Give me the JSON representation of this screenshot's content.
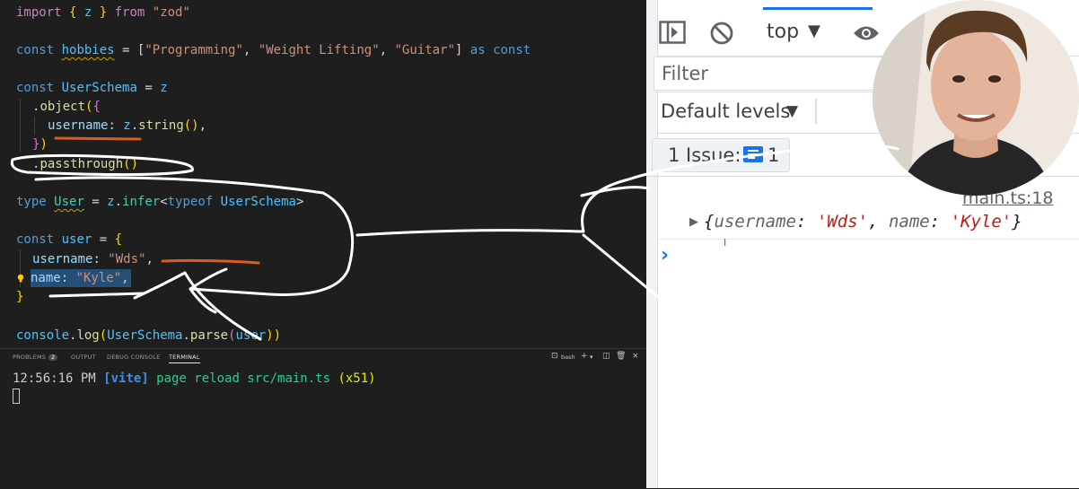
{
  "code": {
    "l1": {
      "a": "import",
      "b": " { ",
      "c": "z",
      "d": " } ",
      "e": "from",
      "f": " ",
      "g": "\"zod\""
    },
    "l3": {
      "a": "const",
      "b": " ",
      "c": "hobbies",
      "d": " = [",
      "e": "\"Programming\"",
      "f": ", ",
      "g": "\"Weight Lifting\"",
      "h": ", ",
      "i": "\"Guitar\"",
      "j": "] ",
      "k": "as",
      "l": " ",
      "m": "const"
    },
    "l5": {
      "a": "const",
      "b": " ",
      "c": "UserSchema",
      "d": " = ",
      "e": "z"
    },
    "l6": {
      "a": ".",
      "b": "object",
      "c": "(",
      "d": "{"
    },
    "l7": {
      "a": "username",
      "b": ": ",
      "c": "z",
      "d": ".",
      "e": "string",
      "f": "()",
      "g": ","
    },
    "l8": {
      "a": "}",
      "b": ")"
    },
    "l9": {
      "a": ".",
      "b": "passthrough",
      "c": "()"
    },
    "l11": {
      "a": "type",
      "b": " ",
      "c": "User",
      "d": " = ",
      "e": "z",
      "f": ".",
      "g": "infer",
      "h": "<",
      "i": "typeof",
      "j": " ",
      "k": "UserSchema",
      "l": ">"
    },
    "l13": {
      "a": "const",
      "b": " ",
      "c": "user",
      "d": " = ",
      "e": "{"
    },
    "l14": {
      "a": "username",
      "b": ": ",
      "c": "\"Wds\"",
      "d": ","
    },
    "l15": {
      "a": "name",
      "b": ": ",
      "c": "\"Kyle\"",
      "d": ","
    },
    "l16": {
      "a": "}"
    },
    "l18": {
      "a": "console",
      "b": ".",
      "c": "log",
      "d": "(",
      "e": "UserSchema",
      "f": ".",
      "g": "parse",
      "h": "(",
      "i": "user",
      "j": "))"
    }
  },
  "panel": {
    "tabs": {
      "problems": "PROBLEMS",
      "problems_count": "2",
      "output": "OUTPUT",
      "debug": "DEBUG CONSOLE",
      "terminal": "TERMINAL"
    },
    "shell": "bash",
    "terminal": {
      "time": "12:56:16 PM ",
      "tag": "[vite]",
      "msg": " page reload src/main.ts ",
      "count": "(x51)"
    }
  },
  "devtools": {
    "context": "top",
    "filter_placeholder": "Filter",
    "levels": "Default levels",
    "issues_label": "1 Issue:",
    "issues_count": "1",
    "source_link": "main.ts:18",
    "log": {
      "open": "{",
      "k1": "username",
      "sep1": ": ",
      "v1": "'Wds'",
      "comma": ", ",
      "k2": "name",
      "sep2": ": ",
      "v2": "'Kyle'",
      "close": "}"
    },
    "prompt": "›"
  },
  "colors": {
    "editor_bg": "#1e1e1e",
    "selection": "#264f78",
    "annotation_orange": "#e05a1a",
    "annotation_white": "#ffffff",
    "accent_blue": "#1a73e8",
    "console_value": "#c41a16"
  }
}
